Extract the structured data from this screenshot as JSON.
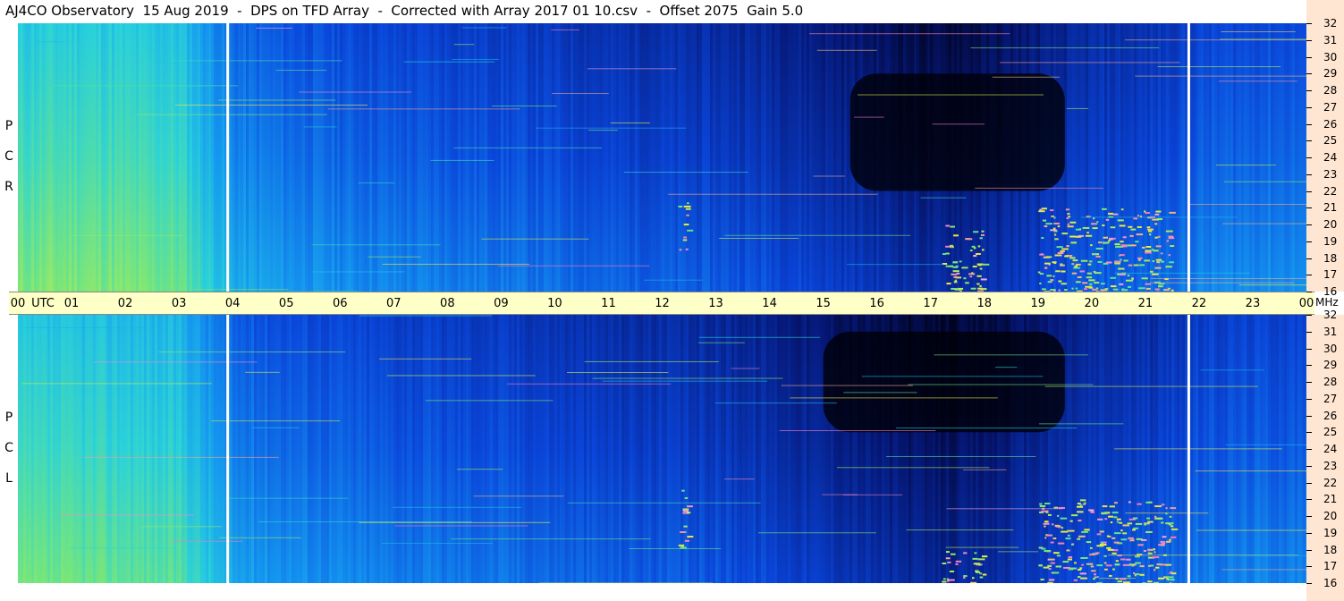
{
  "header": {
    "title": "AJ4CO Observatory  15 Aug 2019  -  DPS on TFD Array  -  Corrected with Array 2017 01 10.csv  -  Offset 2075  Gain 5.0"
  },
  "panels": [
    {
      "id": "rcp",
      "label_letters": [
        "P",
        "C",
        "R"
      ]
    },
    {
      "id": "lcp",
      "label_letters": [
        "P",
        "C",
        "L"
      ]
    }
  ],
  "time_axis": {
    "ticks": [
      "00",
      "UTC",
      "01",
      "02",
      "03",
      "04",
      "05",
      "06",
      "07",
      "08",
      "09",
      "10",
      "11",
      "12",
      "13",
      "14",
      "15",
      "16",
      "17",
      "18",
      "19",
      "20",
      "21",
      "22",
      "23",
      "00"
    ],
    "unit_label": "MHz"
  },
  "freq_axis": {
    "ticks": [
      "32",
      "31",
      "30",
      "29",
      "28",
      "27",
      "26",
      "25",
      "24",
      "23",
      "22",
      "21",
      "20",
      "19",
      "18",
      "17",
      "16"
    ]
  },
  "chart_data": {
    "type": "heatmap",
    "title": "AJ4CO Observatory  15 Aug 2019  -  DPS on TFD Array  -  Corrected with Array 2017 01 10.csv  -  Offset 2075  Gain 5.0",
    "x": {
      "unit": "UTC hours",
      "range": [
        0,
        24
      ]
    },
    "y": {
      "unit": "MHz",
      "range": [
        16,
        32
      ]
    },
    "series": [
      {
        "name": "RCP",
        "intensity_by_hour": [
          0.62,
          0.63,
          0.62,
          0.6,
          0.42,
          0.38,
          0.36,
          0.34,
          0.33,
          0.32,
          0.3,
          0.28,
          0.27,
          0.26,
          0.24,
          0.2,
          0.16,
          0.12,
          0.14,
          0.2,
          0.26,
          0.28,
          0.34,
          0.36
        ],
        "dark_region": {
          "x": [
            15.5,
            19.5
          ],
          "y": [
            22,
            29
          ]
        },
        "bright_regions": [
          {
            "x": [
              17.2,
              18.0
            ],
            "y": [
              16,
              20
            ]
          },
          {
            "x": [
              19.0,
              21.5
            ],
            "y": [
              16,
              21
            ]
          },
          {
            "x": [
              12.3,
              12.5
            ],
            "y": [
              18.5,
              21.5
            ]
          }
        ],
        "vertical_gaps": [
          3.9,
          21.8
        ]
      },
      {
        "name": "LCP",
        "intensity_by_hour": [
          0.6,
          0.6,
          0.59,
          0.57,
          0.4,
          0.37,
          0.35,
          0.33,
          0.32,
          0.31,
          0.29,
          0.27,
          0.26,
          0.25,
          0.22,
          0.18,
          0.14,
          0.1,
          0.12,
          0.18,
          0.24,
          0.26,
          0.32,
          0.34
        ],
        "dark_region": {
          "x": [
            15.0,
            19.5
          ],
          "y": [
            25,
            31
          ]
        },
        "bright_regions": [
          {
            "x": [
              17.2,
              18.0
            ],
            "y": [
              16,
              18
            ]
          },
          {
            "x": [
              19.0,
              21.5
            ],
            "y": [
              16,
              21
            ]
          },
          {
            "x": [
              12.3,
              12.5
            ],
            "y": [
              18,
              22
            ]
          }
        ],
        "vertical_gaps": [
          3.9,
          21.8
        ]
      }
    ]
  }
}
